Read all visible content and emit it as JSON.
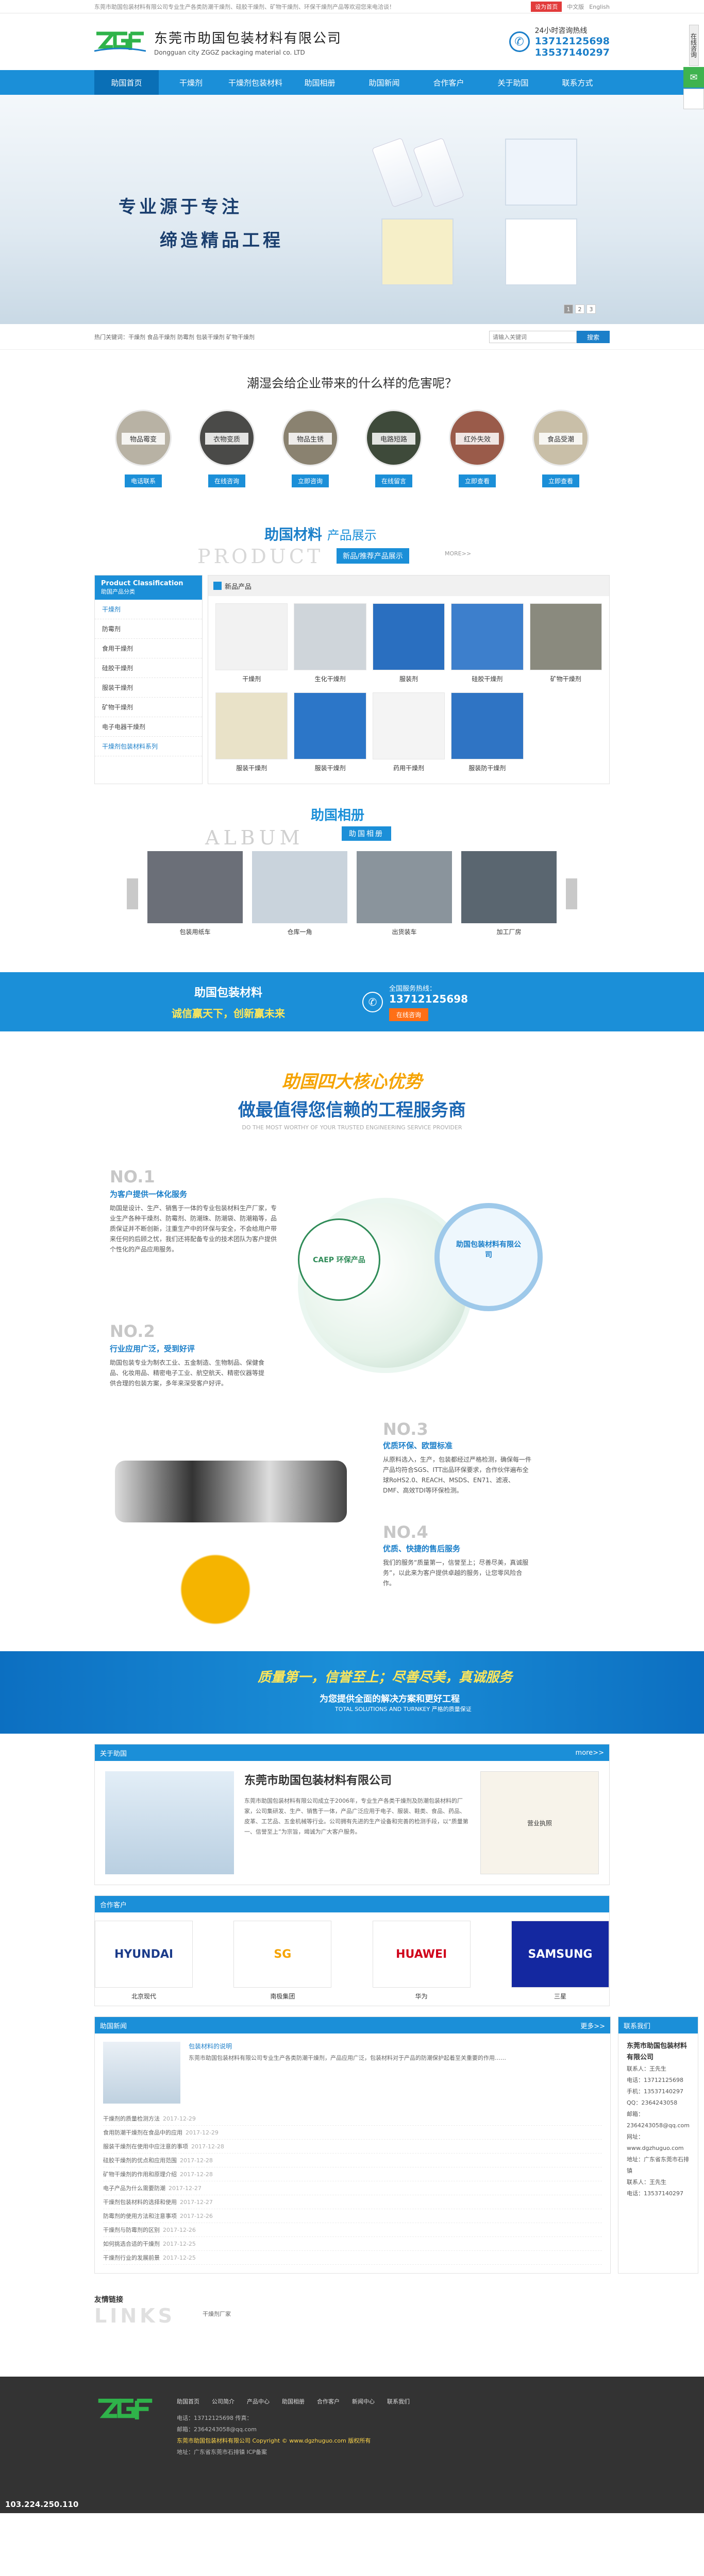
{
  "topbar": {
    "text": "东莞市助国包装材料有限公司专业生产各类防潮干燥剂、硅胶干燥剂、矿物干燥剂、环保干燥剂产品等欢迎您来电洽谈！",
    "fav": "设为首页",
    "lang": "中文版",
    "lang2": "English"
  },
  "header": {
    "company_cn": "东莞市助国包装材料有限公司",
    "company_en": "Dongguan city ZGGZ packaging material co. LTD",
    "hotline_label": "24小时咨询热线",
    "phone1": "13712125698",
    "phone2": "13537140297",
    "logo": "ZGF"
  },
  "nav": [
    "助国首页",
    "干燥剂",
    "干燥剂包装材料",
    "助国相册",
    "助国新闻",
    "合作客户",
    "关于助国",
    "联系方式"
  ],
  "banner": {
    "slogan1": "专业源于专注",
    "slogan2": "缔造精品工程",
    "dots": [
      "1",
      "2",
      "3"
    ]
  },
  "search": {
    "hot": "热门关键词：干燥剂 食品干燥剂 防霉剂 包装干燥剂 矿物干燥剂",
    "placeholder": "请输入关键词",
    "button": "搜索"
  },
  "dangers": {
    "title": "潮湿会给企业带来的什么样的危害呢？",
    "items": [
      {
        "tag": "物品霉变",
        "btn": "电话联系"
      },
      {
        "tag": "衣物变质",
        "btn": "在线咨询"
      },
      {
        "tag": "物品生锈",
        "btn": "立即咨询"
      },
      {
        "tag": "电路短路",
        "btn": "在线留言"
      },
      {
        "tag": "红外失效",
        "btn": "立即查看"
      },
      {
        "tag": "食品受潮",
        "btn": "立即查看"
      }
    ]
  },
  "products": {
    "cn": "助国材料",
    "cn2": "产品展示",
    "en": "PRODUCT",
    "sub": "新品/推荐产品展示",
    "more": "MORE>>",
    "cat_title": "Product Classification",
    "cat_sub": "助国产品分类",
    "cats": [
      "干燥剂",
      "防霉剂",
      "食用干燥剂",
      "硅胶干燥剂",
      "服装干燥剂",
      "矿物干燥剂",
      "电子电器干燥剂",
      "干燥剂包装材料系列"
    ],
    "list_title": "新品产品",
    "items": [
      "干燥剂",
      "生化干燥剂",
      "服装剂",
      "硅胶干燥剂",
      "矿物干燥剂",
      "服装干燥剂",
      "服装干燥剂",
      "药用干燥剂",
      "服装防干燥剂"
    ]
  },
  "album": {
    "cn": "助国相册",
    "en": "ALBUM",
    "sub": "助国相册",
    "items": [
      "包装用纸车",
      "仓库一角",
      "出货装车",
      "加工厂房"
    ]
  },
  "bluebar": {
    "title": "助国包装材料",
    "tag": "诚信赢天下，创新赢未来",
    "label": "全国服务热线：",
    "phone": "13712125698",
    "btn": "在线咨询"
  },
  "advantages": {
    "title1": "助国四大核心优势",
    "title2": "做最值得您信赖的工程服务商",
    "en": "DO THE MOST WORTHY OF YOUR TRUSTED ENGINEERING SERVICE PROVIDER",
    "items": [
      {
        "no": "NO.1",
        "h": "为客户提供一体化服务",
        "p": "助国是设计、生产、销售于一体的专业包装材料生产厂家，专业生产各种干燥剂、防霉剂、防潮珠、防潮袋、防潮箱等，品质保证并不断创新，注重生产中的环保与安全，不会给用户带来任何的后顾之忧，我们还将配备专业的技术团队为客户提供个性化的产品应用服务。"
      },
      {
        "no": "NO.2",
        "h": "行业应用广泛，受到好评",
        "p": "助国包装专业为制衣工业、五金制造、生物制品、保健食品、化妆用品、精密电子工业、航空航天、精密仪器等提供合理的包装方案，多年来深受客户好评。"
      },
      {
        "no": "NO.3",
        "h": "优质环保、欧盟标准",
        "p": "从原料选入，生产，包装都经过严格检测，确保每一件产品均符合SGS、ITT出品环保要求，合作伙伴遍布全球RoHS2.0、REACH、MSDS、EN71、滤液、DMF、高效TDI等环保检测。"
      },
      {
        "no": "NO.4",
        "h": "优质、快捷的售后服务",
        "p": "我们的服务“质量第一，信誉至上；尽善尽美，真诚服务”，以此来为客户提供卓越的服务，让您零风险合作。"
      }
    ],
    "seal": "CAEP 环保产品",
    "ring": "助国包装材料有限公司"
  },
  "quality": {
    "line1": "质量第一，信誉至上；尽善尽美，真诚服务",
    "line2": "为您提供全面的解决方案和更好工程",
    "line3": "TOTAL SOLUTIONS AND TURNKEY 严格的质量保证"
  },
  "about": {
    "h": "关于助国",
    "more": "more>>",
    "title": "东莞市助国包装材料有限公司",
    "text": "东莞市助国包装材料有限公司成立于2006年，专业生产各类干燥剂及防潮包装材料的厂家，公司集研发、生产、销售于一体，产品广泛应用于电子、服装、鞋类、食品、药品、皮革、工艺品、五金机械等行业。公司拥有先进的生产设备和完善的检测手段，以“质量第一、信誉至上”为宗旨，竭诚为广大客户服务。",
    "cert": "营业执照"
  },
  "partners": {
    "h": "合作客户",
    "items": [
      {
        "name": "北京现代",
        "logo": "HYUNDAI"
      },
      {
        "name": "南极集团",
        "logo": "SG"
      },
      {
        "name": "华为",
        "logo": "HUAWEI"
      },
      {
        "name": "三星",
        "logo": "SAMSUNG"
      }
    ]
  },
  "news": {
    "h": "助国新闻",
    "more": "更多>>",
    "top_title": "包装材料的说明",
    "top_text": "东莞市助国包装材料有限公司专业生产各类防潮干燥剂，产品应用广泛，包装材料对于产品的防潮保护起着至关重要的作用……",
    "items": [
      {
        "t": "干燥剂的质量检测方法",
        "d": "2017-12-29"
      },
      {
        "t": "食用防潮干燥剂在食品中的应用",
        "d": "2017-12-29"
      },
      {
        "t": "服装干燥剂在使用中应注意的事项",
        "d": "2017-12-28"
      },
      {
        "t": "硅胶干燥剂的优点和应用范围",
        "d": "2017-12-28"
      },
      {
        "t": "矿物干燥剂的作用和原理介绍",
        "d": "2017-12-28"
      },
      {
        "t": "电子产品为什么需要防潮",
        "d": "2017-12-27"
      },
      {
        "t": "干燥剂包装材料的选择和使用",
        "d": "2017-12-27"
      },
      {
        "t": "防霉剂的使用方法和注意事项",
        "d": "2017-12-26"
      },
      {
        "t": "干燥剂与防霉剂的区别",
        "d": "2017-12-26"
      },
      {
        "t": "如何挑选合适的干燥剂",
        "d": "2017-12-25"
      },
      {
        "t": "干燥剂行业的发展前景",
        "d": "2017-12-25"
      }
    ]
  },
  "contact": {
    "h": "联系我们",
    "company": "东莞市助国包装材料有限公司",
    "lines": [
      "联系人：王先生",
      "电话：13712125698",
      "手机：13537140297",
      "QQ：2364243058",
      "邮箱：2364243058@qq.com",
      "网址：www.dgzhuguo.com",
      "地址：广东省东莞市石排镇",
      "联系人：王先生",
      "电话：13537140297"
    ]
  },
  "links": {
    "t": "友情链接",
    "en": "LINKS",
    "l": "干燥剂厂家"
  },
  "footer": {
    "nav": [
      "助国首页",
      "公司简介",
      "产品中心",
      "助国相册",
      "合作客户",
      "新闻中心",
      "联系我们"
    ],
    "tel": "电话：13712125698  传真：",
    "mail": "邮箱：2364243058@qq.com",
    "copy": "东莞市助国包装材料有限公司  Copyright © www.dgzhuguo.com 版权所有",
    "addr": "地址：广东省东莞市石排镇  ICP备案",
    "ip": "103.224.250.110"
  },
  "float": {
    "a": "在线咨询"
  }
}
